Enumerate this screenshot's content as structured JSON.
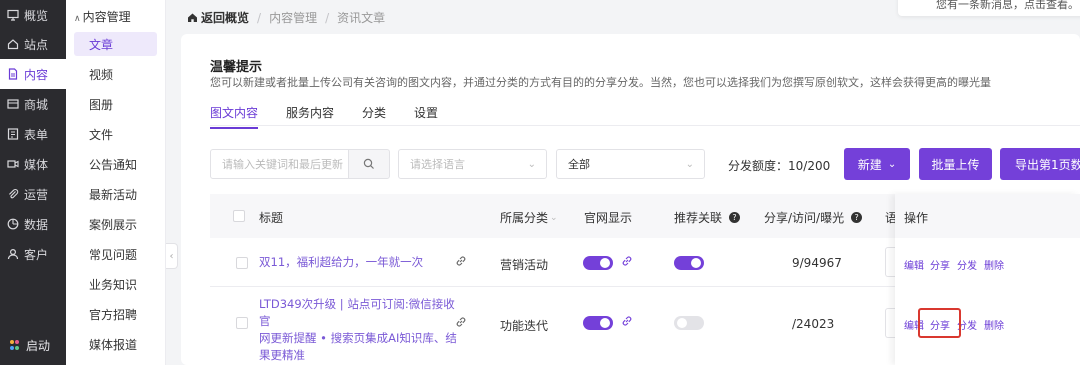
{
  "nav": {
    "items": [
      {
        "label": "概览",
        "icon": "monitor-icon"
      },
      {
        "label": "站点",
        "icon": "home-icon"
      },
      {
        "label": "内容",
        "icon": "document-icon"
      },
      {
        "label": "商城",
        "icon": "store-icon"
      },
      {
        "label": "表单",
        "icon": "form-icon"
      },
      {
        "label": "媒体",
        "icon": "video-icon"
      },
      {
        "label": "运营",
        "icon": "paperclip-icon"
      },
      {
        "label": "数据",
        "icon": "chart-icon"
      },
      {
        "label": "客户",
        "icon": "user-icon"
      }
    ],
    "launch_label": "启动"
  },
  "subnav": {
    "group_label": "内容管理",
    "items": [
      "文章",
      "视频",
      "图册",
      "文件",
      "公告通知",
      "最新活动",
      "案例展示",
      "常见问题",
      "业务知识",
      "官方招聘",
      "媒体报道"
    ]
  },
  "breadcrumb": {
    "back": "返回概览",
    "level1": "内容管理",
    "level2": "资讯文章"
  },
  "toast_text": "您有一条新消息，点击查看。",
  "tip": {
    "title": "温馨提示",
    "desc": "您可以新建或者批量上传公司有关咨询的图文内容，并通过分类的方式有目的的分享分发。当然，您也可以选择我们为您撰写原创软文，这样会获得更高的曝光量"
  },
  "tabs": [
    "图文内容",
    "服务内容",
    "分类",
    "设置"
  ],
  "filters": {
    "search_placeholder": "请输入关键词和最后更新",
    "lang_placeholder": "请选择语言",
    "category_value": "全部",
    "quota": "分发额度：10/200"
  },
  "buttons": {
    "new": "新建",
    "batch_upload": "批量上传",
    "export": "导出第1页数据"
  },
  "table": {
    "headers": {
      "title": "标题",
      "category": "所属分类",
      "site_display": "官网显示",
      "recommend": "推荐关联",
      "stats": "分享/访问/曝光",
      "lang": "语",
      "actions": "操作"
    },
    "rows": [
      {
        "title": "双11，福利超给力，一年就一次",
        "category": "营销活动",
        "site_display": true,
        "recommend": true,
        "stats": "9/94967"
      },
      {
        "title": "LTD349次升级 | 站点可订阅:微信接收官网更新提醒 • 搜索页集成AI知识库、结果更精准",
        "title_lines": [
          "LTD349次升级 | 站点可订阅:微信接收官",
          "网更新提醒 • 搜索页集成AI知识库、结",
          "果更精准"
        ],
        "category": "功能迭代",
        "site_display": true,
        "recommend": false,
        "stats": "/24023"
      }
    ],
    "actions": [
      "编辑",
      "分享",
      "分发",
      "删除"
    ]
  },
  "colors": {
    "accent": "#7440d9",
    "nav_bg": "#2b2b2f",
    "highlight": "#d9382f"
  }
}
